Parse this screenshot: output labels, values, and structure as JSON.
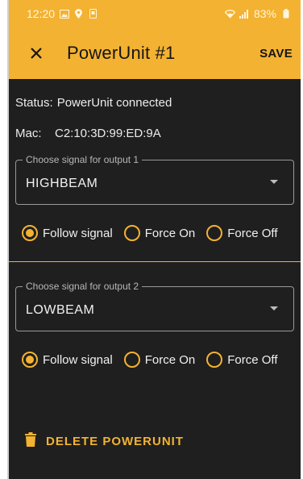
{
  "status_bar": {
    "time": "12:20",
    "battery": "83%",
    "icons": [
      "gallery-icon",
      "location-icon",
      "phone-icon",
      "wifi-icon",
      "signal-icon",
      "battery-icon"
    ]
  },
  "app_bar": {
    "close_icon": "close-icon",
    "title": "PowerUnit #1",
    "save_label": "SAVE"
  },
  "info": {
    "status_label": "Status:",
    "status_value": "PowerUnit connected",
    "mac_label": "Mac:",
    "mac_value": "C2:10:3D:99:ED:9A"
  },
  "outputs": [
    {
      "legend": "Choose signal for output 1",
      "selected": "HIGHBEAM",
      "options": [
        "Follow signal",
        "Force On",
        "Force Off"
      ],
      "selected_option": "Follow signal"
    },
    {
      "legend": "Choose signal for output 2",
      "selected": "LOWBEAM",
      "options": [
        "Follow signal",
        "Force On",
        "Force Off"
      ],
      "selected_option": "Follow signal"
    }
  ],
  "delete": {
    "label": "DELETE POWERUNIT",
    "icon": "trash-icon"
  },
  "colors": {
    "accent": "#f3b232",
    "background": "#1f1f1f",
    "text": "#ececec"
  }
}
